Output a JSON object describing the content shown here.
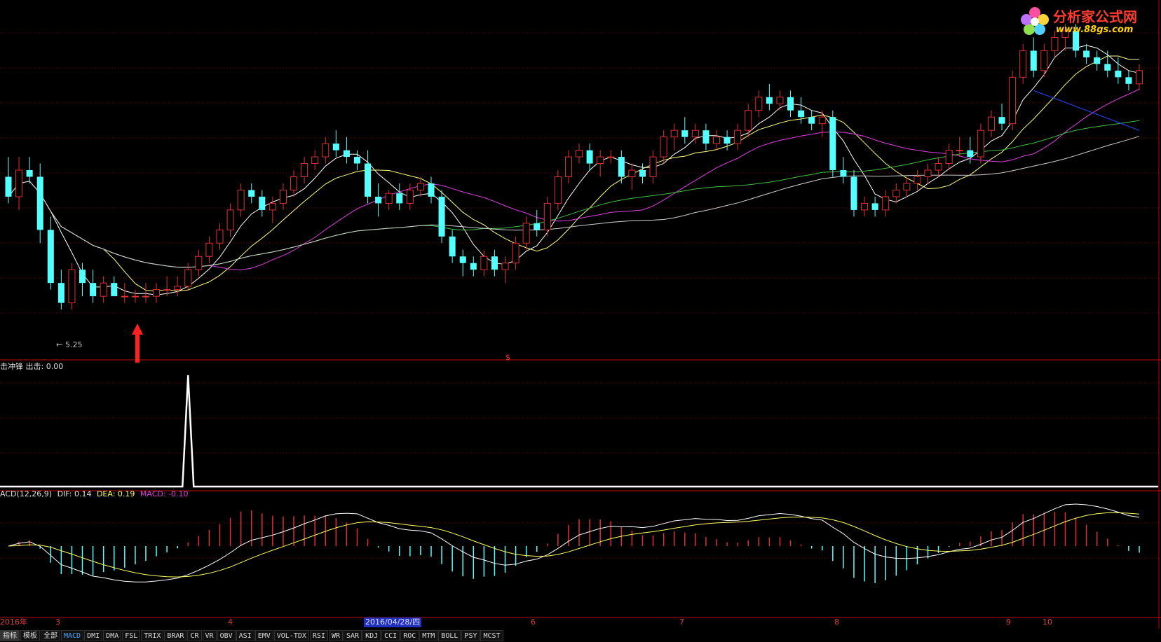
{
  "logo": {
    "name": "分析家公式网",
    "url": "www.88gs.com"
  },
  "main_chart": {
    "low_label": "5.25",
    "marker_label": "$"
  },
  "sub_indicator": {
    "label": "击冲锋 出击: 0.00"
  },
  "macd_header": {
    "name": "ACD(12,26,9)",
    "dif": "DIF: 0.14",
    "dea": "DEA: 0.19",
    "macd": "MACD: -0.10"
  },
  "date_axis": {
    "labels": [
      "2016年",
      "3",
      "4",
      "2016/04/28/四",
      "6",
      "7",
      "8",
      "9",
      "10"
    ]
  },
  "tabs": [
    "指标",
    "模板",
    "全部",
    "MACD",
    "DMI",
    "DMA",
    "FSL",
    "TRIX",
    "BRAR",
    "CR",
    "VR",
    "OBV",
    "ASI",
    "EMV",
    "VOL-TDX",
    "RSI",
    "WR",
    "SAR",
    "KDJ",
    "CCI",
    "ROC",
    "MTM",
    "BOLL",
    "PSY",
    "MCST"
  ],
  "active_tab": "MACD",
  "colors": {
    "up": "#e03030",
    "down": "#54ffff",
    "ma5": "#ffffff",
    "ma10": "#ffff80",
    "ma20": "#e040e0",
    "ma60": "#40c040",
    "ma120": "#d0d0d0",
    "blue_line": "#2040e0",
    "grid": "#800000"
  },
  "chart_data": {
    "type": "candlestick",
    "candles": [
      [
        7.6,
        7.9,
        7.2,
        7.3
      ],
      [
        7.3,
        7.9,
        7.1,
        7.7
      ],
      [
        7.7,
        7.9,
        7.5,
        7.6
      ],
      [
        7.6,
        7.8,
        6.6,
        6.8
      ],
      [
        6.8,
        7.0,
        5.9,
        6.0
      ],
      [
        6.0,
        6.2,
        5.6,
        5.7
      ],
      [
        5.7,
        6.3,
        5.6,
        6.2
      ],
      [
        6.2,
        6.3,
        5.8,
        6.0
      ],
      [
        6.0,
        6.2,
        5.7,
        5.8
      ],
      [
        5.8,
        6.1,
        5.7,
        6.0
      ],
      [
        6.0,
        6.1,
        5.8,
        5.8
      ],
      [
        5.8,
        6.0,
        5.7,
        5.8
      ],
      [
        5.8,
        5.9,
        5.7,
        5.8
      ],
      [
        5.8,
        6.0,
        5.7,
        5.8
      ],
      [
        5.8,
        6.0,
        5.7,
        5.9
      ],
      [
        5.9,
        6.1,
        5.8,
        5.9
      ],
      [
        5.9,
        6.1,
        5.8,
        5.95
      ],
      [
        5.95,
        6.3,
        5.9,
        6.2
      ],
      [
        6.2,
        6.5,
        6.1,
        6.4
      ],
      [
        6.4,
        6.7,
        6.3,
        6.6
      ],
      [
        6.6,
        6.9,
        6.5,
        6.8
      ],
      [
        6.8,
        7.2,
        6.7,
        7.1
      ],
      [
        7.1,
        7.5,
        7.0,
        7.4
      ],
      [
        7.4,
        7.5,
        7.2,
        7.3
      ],
      [
        7.3,
        7.4,
        7.0,
        7.1
      ],
      [
        7.1,
        7.3,
        6.9,
        7.2
      ],
      [
        7.2,
        7.5,
        7.1,
        7.4
      ],
      [
        7.4,
        7.7,
        7.3,
        7.6
      ],
      [
        7.6,
        7.9,
        7.5,
        7.8
      ],
      [
        7.8,
        8.0,
        7.7,
        7.9
      ],
      [
        7.9,
        8.2,
        7.8,
        8.1
      ],
      [
        8.1,
        8.3,
        7.9,
        8.0
      ],
      [
        8.0,
        8.2,
        7.8,
        7.9
      ],
      [
        7.9,
        8.0,
        7.7,
        7.8
      ],
      [
        7.8,
        8.0,
        7.2,
        7.3
      ],
      [
        7.3,
        7.5,
        7.0,
        7.2
      ],
      [
        7.2,
        7.4,
        7.1,
        7.35
      ],
      [
        7.35,
        7.5,
        7.1,
        7.2
      ],
      [
        7.2,
        7.5,
        7.1,
        7.4
      ],
      [
        7.4,
        7.6,
        7.3,
        7.5
      ],
      [
        7.5,
        7.6,
        7.2,
        7.3
      ],
      [
        7.3,
        7.4,
        6.6,
        6.7
      ],
      [
        6.7,
        6.8,
        6.3,
        6.4
      ],
      [
        6.4,
        6.5,
        6.1,
        6.3
      ],
      [
        6.3,
        6.4,
        6.1,
        6.2
      ],
      [
        6.2,
        6.5,
        6.1,
        6.4
      ],
      [
        6.4,
        6.5,
        6.1,
        6.2
      ],
      [
        6.2,
        6.4,
        6.0,
        6.3
      ],
      [
        6.3,
        6.7,
        6.2,
        6.6
      ],
      [
        6.6,
        7.0,
        6.5,
        6.9
      ],
      [
        6.9,
        7.1,
        6.7,
        6.8
      ],
      [
        6.8,
        7.3,
        6.7,
        7.2
      ],
      [
        7.2,
        7.7,
        7.1,
        7.6
      ],
      [
        7.6,
        8.0,
        7.5,
        7.9
      ],
      [
        7.9,
        8.1,
        7.8,
        8.0
      ],
      [
        8.0,
        8.1,
        7.7,
        7.8
      ],
      [
        7.8,
        8.0,
        7.6,
        7.9
      ],
      [
        7.9,
        8.0,
        7.8,
        7.9
      ],
      [
        7.9,
        8.0,
        7.5,
        7.6
      ],
      [
        7.6,
        7.8,
        7.4,
        7.7
      ],
      [
        7.7,
        7.8,
        7.5,
        7.6
      ],
      [
        7.6,
        8.0,
        7.5,
        7.9
      ],
      [
        7.9,
        8.3,
        7.8,
        8.2
      ],
      [
        8.2,
        8.4,
        8.0,
        8.3
      ],
      [
        8.3,
        8.5,
        8.1,
        8.2
      ],
      [
        8.2,
        8.4,
        8.1,
        8.3
      ],
      [
        8.3,
        8.4,
        8.0,
        8.1
      ],
      [
        8.1,
        8.3,
        8.0,
        8.2
      ],
      [
        8.2,
        8.3,
        8.0,
        8.1
      ],
      [
        8.1,
        8.4,
        8.0,
        8.3
      ],
      [
        8.3,
        8.7,
        8.2,
        8.6
      ],
      [
        8.6,
        8.9,
        8.5,
        8.8
      ],
      [
        8.8,
        9.0,
        8.6,
        8.7
      ],
      [
        8.7,
        8.9,
        8.6,
        8.8
      ],
      [
        8.8,
        8.9,
        8.5,
        8.6
      ],
      [
        8.6,
        8.8,
        8.4,
        8.5
      ],
      [
        8.5,
        8.6,
        8.3,
        8.4
      ],
      [
        8.4,
        8.6,
        8.2,
        8.5
      ],
      [
        8.5,
        8.6,
        7.6,
        7.7
      ],
      [
        7.7,
        7.9,
        7.5,
        7.6
      ],
      [
        7.6,
        7.7,
        7.0,
        7.1
      ],
      [
        7.1,
        7.3,
        7.0,
        7.2
      ],
      [
        7.2,
        7.3,
        7.0,
        7.1
      ],
      [
        7.1,
        7.4,
        7.0,
        7.3
      ],
      [
        7.3,
        7.5,
        7.2,
        7.4
      ],
      [
        7.4,
        7.6,
        7.3,
        7.5
      ],
      [
        7.5,
        7.7,
        7.4,
        7.6
      ],
      [
        7.6,
        7.8,
        7.5,
        7.7
      ],
      [
        7.7,
        7.9,
        7.6,
        7.8
      ],
      [
        7.8,
        8.1,
        7.7,
        8.0
      ],
      [
        8.0,
        8.2,
        7.9,
        8.0
      ],
      [
        8.0,
        8.2,
        7.8,
        7.9
      ],
      [
        7.9,
        8.4,
        7.8,
        8.3
      ],
      [
        8.3,
        8.6,
        8.2,
        8.5
      ],
      [
        8.5,
        8.7,
        8.3,
        8.4
      ],
      [
        8.4,
        9.2,
        8.3,
        9.1
      ],
      [
        9.1,
        9.6,
        9.0,
        9.5
      ],
      [
        9.5,
        9.7,
        9.1,
        9.2
      ],
      [
        9.2,
        9.6,
        9.1,
        9.5
      ],
      [
        9.5,
        9.8,
        9.4,
        9.7
      ],
      [
        9.7,
        9.9,
        9.5,
        9.8
      ],
      [
        9.8,
        9.9,
        9.4,
        9.5
      ],
      [
        9.5,
        9.6,
        9.3,
        9.4
      ],
      [
        9.4,
        9.5,
        9.2,
        9.3
      ],
      [
        9.3,
        9.5,
        9.1,
        9.2
      ],
      [
        9.2,
        9.4,
        9.0,
        9.1
      ],
      [
        9.1,
        9.2,
        8.9,
        9.0
      ],
      [
        9.0,
        9.3,
        8.9,
        9.2
      ]
    ],
    "signal_index": 17,
    "macd": {
      "dif": 0.14,
      "dea": 0.19,
      "macd": -0.1
    }
  }
}
